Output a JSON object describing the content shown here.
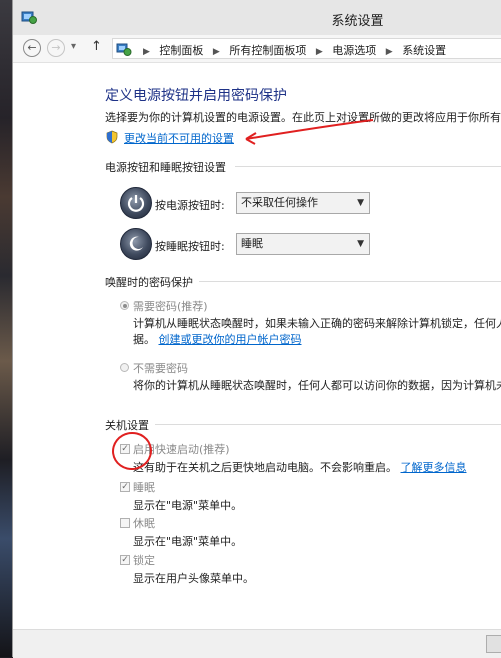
{
  "window": {
    "title": "系统设置"
  },
  "nav": {
    "back": "←",
    "forward": "→",
    "recent": "▾",
    "up": "↑"
  },
  "breadcrumb": [
    "控制面板",
    "所有控制面板项",
    "电源选项",
    "系统设置"
  ],
  "page": {
    "heading": "定义电源按钮并启用密码保护",
    "description": "选择要为你的计算机设置的电源设置。在此页上对设置所做的更改将应用于你所有的",
    "change_link": "更改当前不可用的设置"
  },
  "buttons_section": {
    "title": "电源按钮和睡眠按钮设置",
    "power_label": "按电源按钮时:",
    "power_value": "不采取任何操作",
    "sleep_label": "按睡眠按钮时:",
    "sleep_value": "睡眠"
  },
  "password_section": {
    "title": "唤醒时的密码保护",
    "require_label": "需要密码(推荐)",
    "require_desc1": "计算机从睡眠状态唤醒时，如果未输入正确的密码来解除计算机锁定，任何人",
    "require_desc2": "据。",
    "require_link": "创建或更改你的用户帐户密码",
    "norequire_label": "不需要密码",
    "norequire_desc": "将你的计算机从睡眠状态唤醒时，任何人都可以访问你的数据，因为计算机未"
  },
  "shutdown_section": {
    "title": "关机设置",
    "fast_label": "启用快速启动(推荐)",
    "fast_desc": "这有助于在关机之后更快地启动电脑。不会影响重启。",
    "fast_link": "了解更多信息",
    "sleep_label": "睡眠",
    "sleep_desc": "显示在\"电源\"菜单中。",
    "hibernate_label": "休眠",
    "hibernate_desc": "显示在\"电源\"菜单中。",
    "lock_label": "锁定",
    "lock_desc": "显示在用户头像菜单中。"
  },
  "states": {
    "require_password_selected": true,
    "fast_startup": true,
    "show_sleep": true,
    "show_hibernate": false,
    "show_lock": true
  },
  "colors": {
    "heading": "#1e3287",
    "link": "#0066cc",
    "annotation": "#e02020"
  }
}
